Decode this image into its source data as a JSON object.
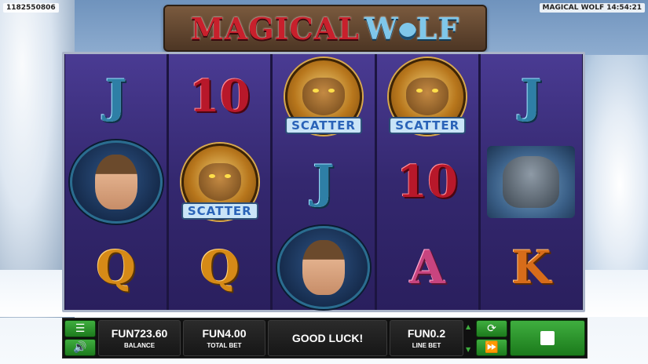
{
  "hud": {
    "session_id": "1182550806",
    "game_clock": "MAGICAL WOLF 14:54:21"
  },
  "logo": {
    "word1": "MAGICAL",
    "word2_a": "W",
    "word2_b": "LF"
  },
  "reels": [
    [
      {
        "type": "letter",
        "value": "J",
        "cls": "J"
      },
      {
        "type": "portrait-woman"
      },
      {
        "type": "letter",
        "value": "Q",
        "cls": "Q"
      }
    ],
    [
      {
        "type": "letter",
        "value": "10",
        "cls": "10"
      },
      {
        "type": "scatter",
        "label": "SCATTER"
      },
      {
        "type": "letter",
        "value": "Q",
        "cls": "Q"
      }
    ],
    [
      {
        "type": "scatter",
        "label": "SCATTER"
      },
      {
        "type": "letter",
        "value": "J",
        "cls": "J"
      },
      {
        "type": "portrait-woman"
      }
    ],
    [
      {
        "type": "scatter",
        "label": "SCATTER"
      },
      {
        "type": "letter",
        "value": "10",
        "cls": "10"
      },
      {
        "type": "letter",
        "value": "A",
        "cls": "A"
      }
    ],
    [
      {
        "type": "letter",
        "value": "J",
        "cls": "J"
      },
      {
        "type": "portrait-wolf"
      },
      {
        "type": "letter",
        "value": "K",
        "cls": "K"
      }
    ]
  ],
  "controls": {
    "menu_icon": "menu-icon",
    "sound_icon": "speaker-icon",
    "balance_value": "FUN723.60",
    "balance_label": "BALANCE",
    "total_bet_value": "FUN4.00",
    "total_bet_label": "TOTAL BET",
    "message": "GOOD LUCK!",
    "line_bet_value": "FUN0.2",
    "line_bet_label": "LINE BET",
    "autoplay_icon": "refresh-icon",
    "turbo_icon": "fast-forward-icon",
    "spin_icon": "stop-icon"
  }
}
